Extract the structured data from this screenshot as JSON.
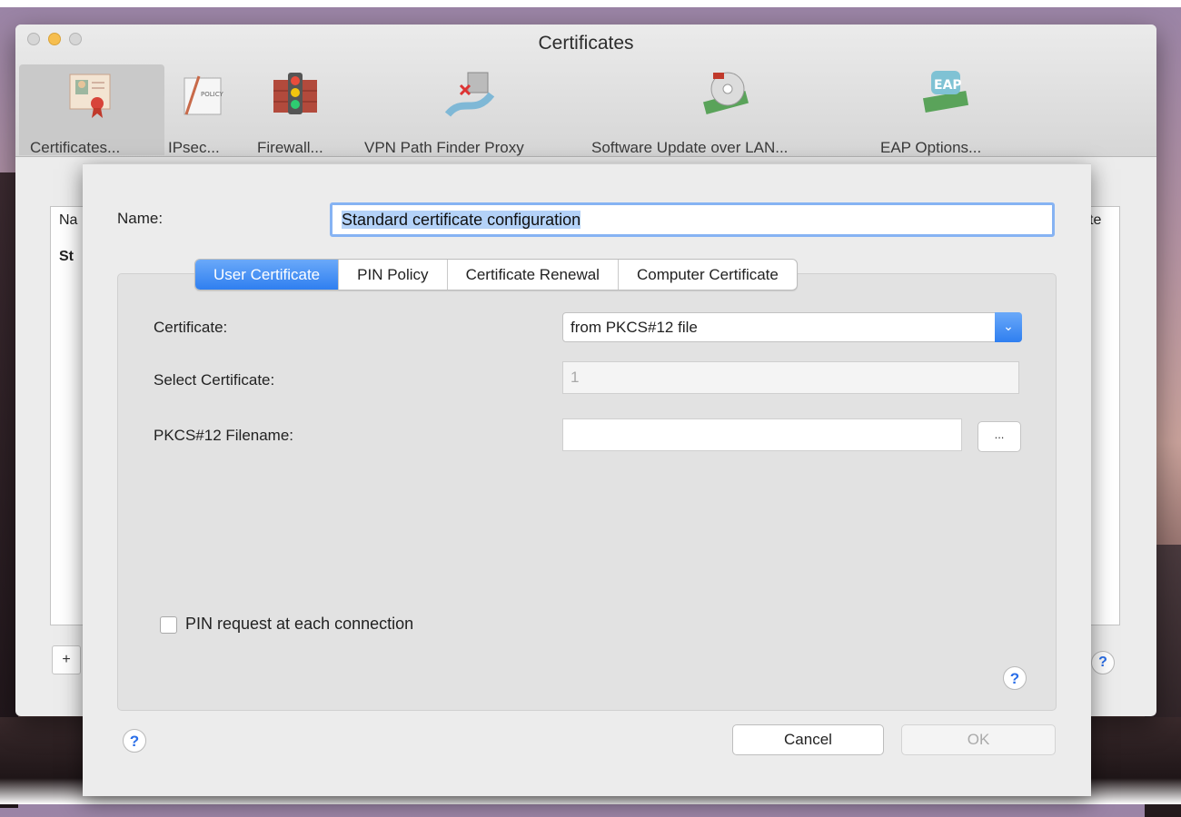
{
  "window": {
    "title": "Certificates",
    "toolbar": [
      {
        "label": "Certificates...",
        "icon": "certificate-icon"
      },
      {
        "label": "IPsec...",
        "icon": "policy-document-icon"
      },
      {
        "label": "Firewall...",
        "icon": "firewall-traffic-light-icon"
      },
      {
        "label": "VPN Path Finder Proxy",
        "icon": "path-finder-icon"
      },
      {
        "label": "Software Update over LAN...",
        "icon": "software-update-disc-icon"
      },
      {
        "label": "EAP Options...",
        "icon": "eap-card-icon"
      }
    ],
    "list": {
      "header_fragment": "Na",
      "row_fragment": "St",
      "right_header_fragment": "te"
    },
    "add_label": "+"
  },
  "dialog": {
    "name_label": "Name:",
    "name_value": "Standard certificate configuration",
    "tabs": [
      {
        "label": "User Certificate",
        "active": true
      },
      {
        "label": "PIN Policy",
        "active": false
      },
      {
        "label": "Certificate Renewal",
        "active": false
      },
      {
        "label": "Computer Certificate",
        "active": false
      }
    ],
    "certificate_label": "Certificate:",
    "certificate_value": "from PKCS#12 file",
    "select_certificate_label": "Select Certificate:",
    "select_certificate_value": "1",
    "pkcs12_label": "PKCS#12 Filename:",
    "pkcs12_value": "",
    "browse_label": "...",
    "pin_request_label": "PIN request at each connection",
    "pin_request_checked": false,
    "help_label": "?",
    "cancel_label": "Cancel",
    "ok_label": "OK"
  },
  "colors": {
    "accent": "#2f7ff0",
    "focus_ring": "#86b3f3",
    "selection": "#b4d2f8"
  }
}
